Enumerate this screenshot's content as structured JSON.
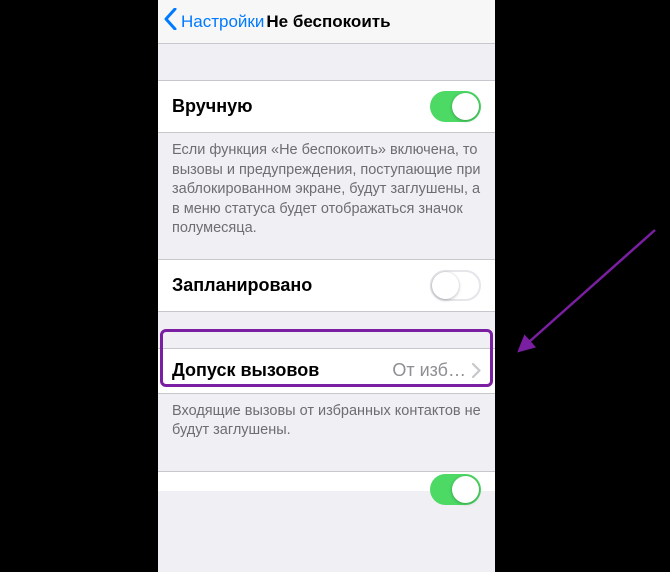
{
  "colors": {
    "accent": "#007aff",
    "toggle_on": "#4cd964",
    "annotation": "#7a1fa2"
  },
  "nav": {
    "back_label": "Настройки",
    "title": "Не беспокоить"
  },
  "rows": {
    "manual": {
      "label": "Вручную",
      "on": true
    },
    "manual_footer": "Если функция «Не беспокоить» включена, то вызовы и предупреждения, поступающие при заблокированном экране, будут заглушены, а в меню статуса будет отображаться значок полумесяца.",
    "scheduled": {
      "label": "Запланировано",
      "on": false
    },
    "allow_calls": {
      "label": "Допуск вызовов",
      "value": "От изб…"
    },
    "allow_calls_footer": "Входящие вызовы от избранных контактов не будут заглушены."
  }
}
